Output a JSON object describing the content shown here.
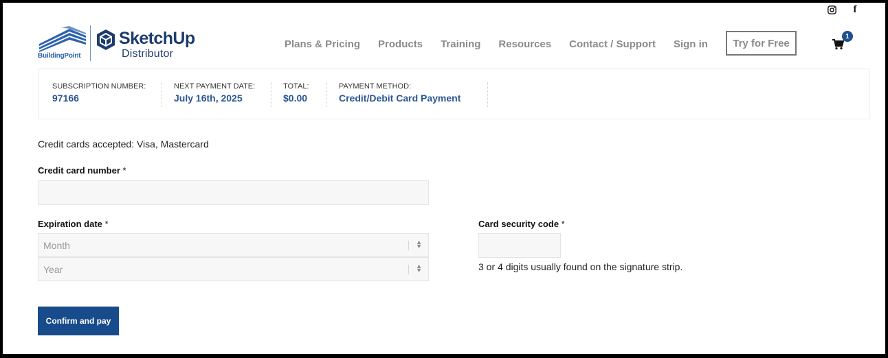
{
  "brand": {
    "buildingpoint": "BuildingPoint",
    "title": "SketchUp",
    "subtitle": "Distributor",
    "accent": "#1d3c6e"
  },
  "nav": {
    "items": [
      "Plans & Pricing",
      "Products",
      "Training",
      "Resources",
      "Contact / Support",
      "Sign in"
    ],
    "cta": "Try for Free",
    "cart_count": "1"
  },
  "social": {
    "icons": [
      "instagram-icon",
      "facebook-icon"
    ],
    "facebook_glyph": "f"
  },
  "summary": [
    {
      "label": "SUBSCRIPTION NUMBER:",
      "value": "97166"
    },
    {
      "label": "NEXT PAYMENT DATE:",
      "value": "July 16th, 2025"
    },
    {
      "label": "TOTAL:",
      "value": "$0.00"
    },
    {
      "label": "PAYMENT METHOD:",
      "value": "Credit/Debit Card Payment"
    }
  ],
  "form": {
    "accepted": "Credit cards accepted: Visa, Mastercard",
    "card_number_label": "Credit card number",
    "required_mark": "*",
    "expiration_label": "Expiration date",
    "month_placeholder": "Month",
    "year_placeholder": "Year",
    "security_label": "Card security code",
    "security_hint": "3 or 4 digits usually found on the signature strip.",
    "submit": "Confirm and pay"
  }
}
